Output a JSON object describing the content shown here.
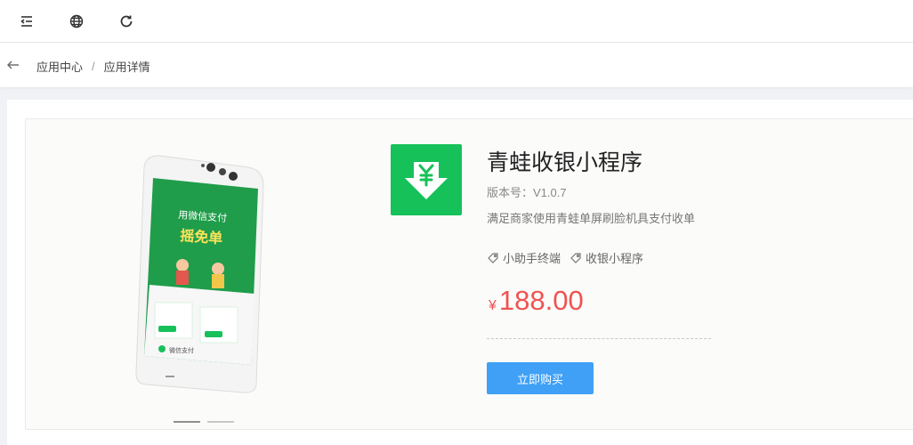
{
  "topbar": {
    "icons": [
      "menu-fold-icon",
      "globe-icon",
      "refresh-icon"
    ]
  },
  "breadcrumb": {
    "items": [
      "应用中心",
      "应用详情"
    ],
    "separator": "/"
  },
  "app": {
    "name": "青蛙收银小程序",
    "version": "版本号：V1.0.7",
    "description": "满足商家使用青蛙单屏刷脸机具支付收单",
    "tags": [
      "小助手终端",
      "收银小程序"
    ],
    "currency": "¥",
    "price": "188.00",
    "buy_label": "立即购买",
    "icon_color": "#17c15a"
  },
  "device_screen": {
    "headline": "用微信支付",
    "promo": "摇免单",
    "footer": "微信支付"
  },
  "carousel": {
    "slide_count": 2,
    "active_index": 0
  },
  "colors": {
    "price": "#ef5350",
    "button": "#3fa0f6",
    "brand_green": "#17c15a"
  }
}
